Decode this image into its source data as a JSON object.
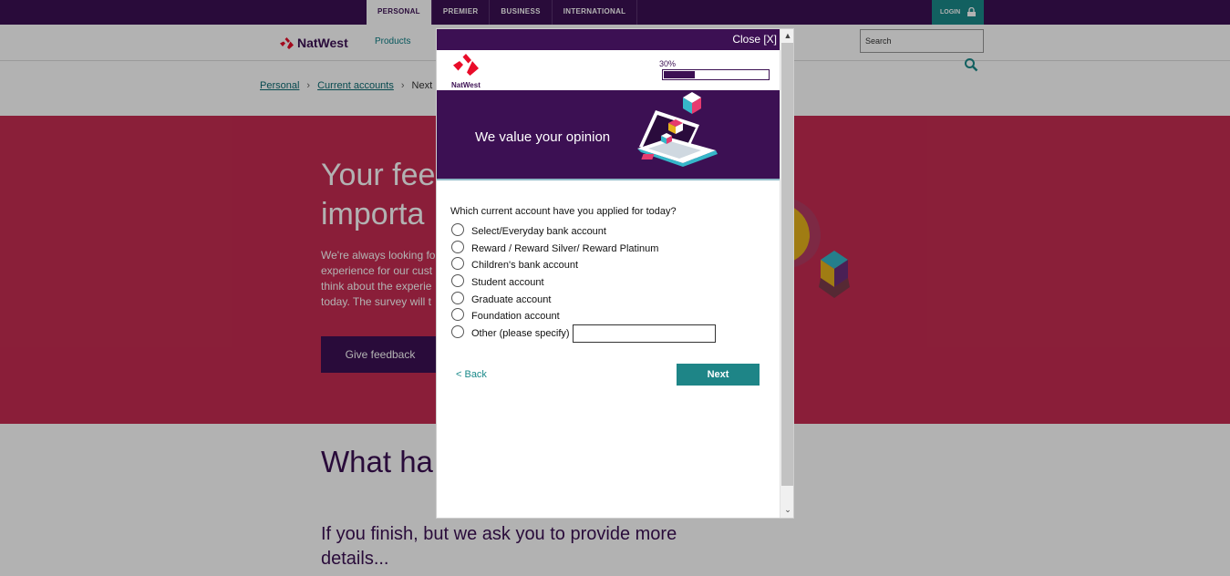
{
  "top_nav": {
    "tabs": [
      {
        "label": "PERSONAL",
        "active": true
      },
      {
        "label": "PREMIER",
        "active": false
      },
      {
        "label": "BUSINESS",
        "active": false
      },
      {
        "label": "INTERNATIONAL",
        "active": false
      }
    ],
    "login_label": "LOGIN"
  },
  "header": {
    "brand": "NatWest",
    "products_label": "Products",
    "search_value": "Search"
  },
  "breadcrumb": {
    "items": [
      "Personal",
      "Current accounts"
    ],
    "current": "Next"
  },
  "hero": {
    "title": "Your fee\nimporta",
    "text": "We're always looking fo experience for our cust think about the experie today. The survey will t",
    "button_label": "Give feedback"
  },
  "section": {
    "title": "What ha",
    "subtitle": "If you finish, but we ask you to provide more details..."
  },
  "modal": {
    "close_label": "Close [X]",
    "brand": "NatWest",
    "progress_label": "30%",
    "progress_value": 0.3,
    "banner_text": "We value your opinion",
    "question": "Which current account have you applied for today?",
    "options": [
      "Select/Everyday bank account",
      "Reward / Reward Silver/ Reward Platinum",
      "Children's bank account",
      "Student account",
      "Graduate account",
      "Foundation account",
      "Other (please specify)"
    ],
    "other_value": "",
    "back_label": "< Back",
    "next_label": "Next"
  },
  "colors": {
    "brand_purple": "#3c1053",
    "teal": "#1a8a8a",
    "hero_red": "#c62c52"
  }
}
